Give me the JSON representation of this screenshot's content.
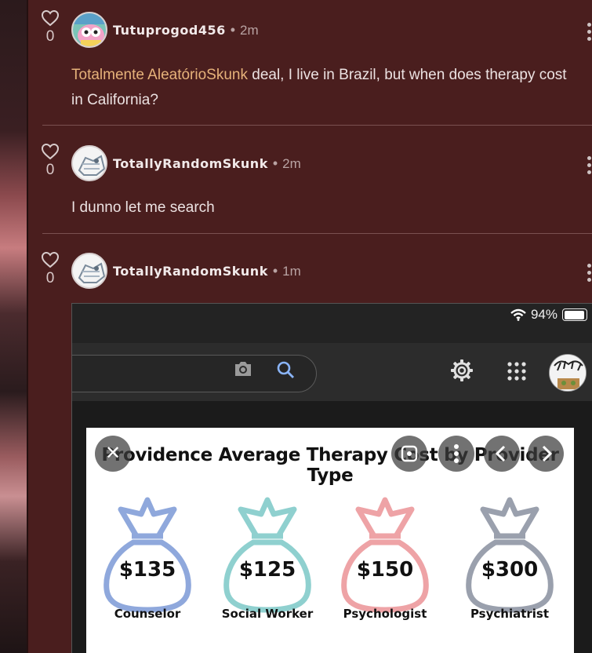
{
  "comments": [
    {
      "votes": "0",
      "username": "Tutuprogod456",
      "time": "2m",
      "mention": "Totalmente AleatórioSkunk",
      "text": " deal, I live in Brazil, but when does therapy cost in California?"
    },
    {
      "votes": "0",
      "username": "TotallyRandomSkunk",
      "time": "2m",
      "text": "I dunno let me search"
    },
    {
      "votes": "0",
      "username": "TotallyRandomSkunk",
      "time": "1m"
    }
  ],
  "screenshot": {
    "battery": "94%",
    "chart_title": "Providence Average Therapy Cost by Provider Type",
    "chart_data": {
      "type": "bar",
      "title": "Providence Average Therapy Cost by Provider Type",
      "categories": [
        "Counselor",
        "Social Worker",
        "Psychologist",
        "Psychiatrist"
      ],
      "values": [
        135,
        125,
        150,
        300
      ],
      "labels": [
        "$135",
        "$125",
        "$150",
        "$300"
      ],
      "colors": [
        "#8fa8dc",
        "#8fd0cf",
        "#eea3a6",
        "#9aa0ad"
      ]
    }
  },
  "icons": [
    "heart-icon",
    "more-vertical-icon",
    "wifi-icon",
    "battery-icon",
    "camera-icon",
    "search-icon",
    "settings-icon",
    "apps-grid-icon",
    "close-icon",
    "lens-icon",
    "info-icon",
    "chevron-left-icon",
    "chevron-right-icon"
  ]
}
